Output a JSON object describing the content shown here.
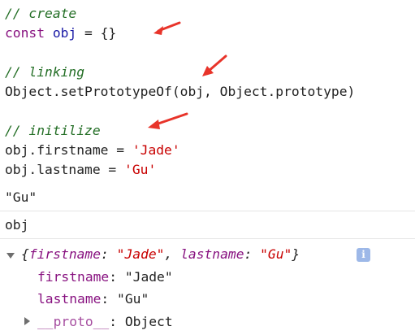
{
  "code": {
    "comment_create": "// create",
    "line_const": [
      "const",
      " ",
      "obj",
      " = {}"
    ],
    "comment_linking": "// linking",
    "line_proto": "Object.setPrototypeOf(obj, Object.prototype)",
    "comment_init": "// initilize",
    "line_first": [
      "obj.firstname = ",
      "'Jade'"
    ],
    "line_last": [
      "obj.lastname = ",
      "'Gu'"
    ]
  },
  "console": {
    "result": "\"Gu\"",
    "input": "obj",
    "object_summary": {
      "open": "{",
      "k1": "firstname",
      "sep1": ": ",
      "v1": "\"Jade\"",
      "comma": ", ",
      "k2": "lastname",
      "sep2": ": ",
      "v2": "\"Gu\"",
      "close": "}"
    },
    "info_icon": "i",
    "props": [
      {
        "key": "firstname",
        "sep": ": ",
        "value": "\"Jade\""
      },
      {
        "key": "lastname",
        "sep": ": ",
        "value": "\"Gu\""
      }
    ],
    "proto": {
      "key": "__proto__",
      "sep": ": ",
      "value": "Object"
    }
  },
  "annotations": {
    "arrow_color": "#e8342a",
    "arrow_icon": "red-annotation-arrow"
  }
}
